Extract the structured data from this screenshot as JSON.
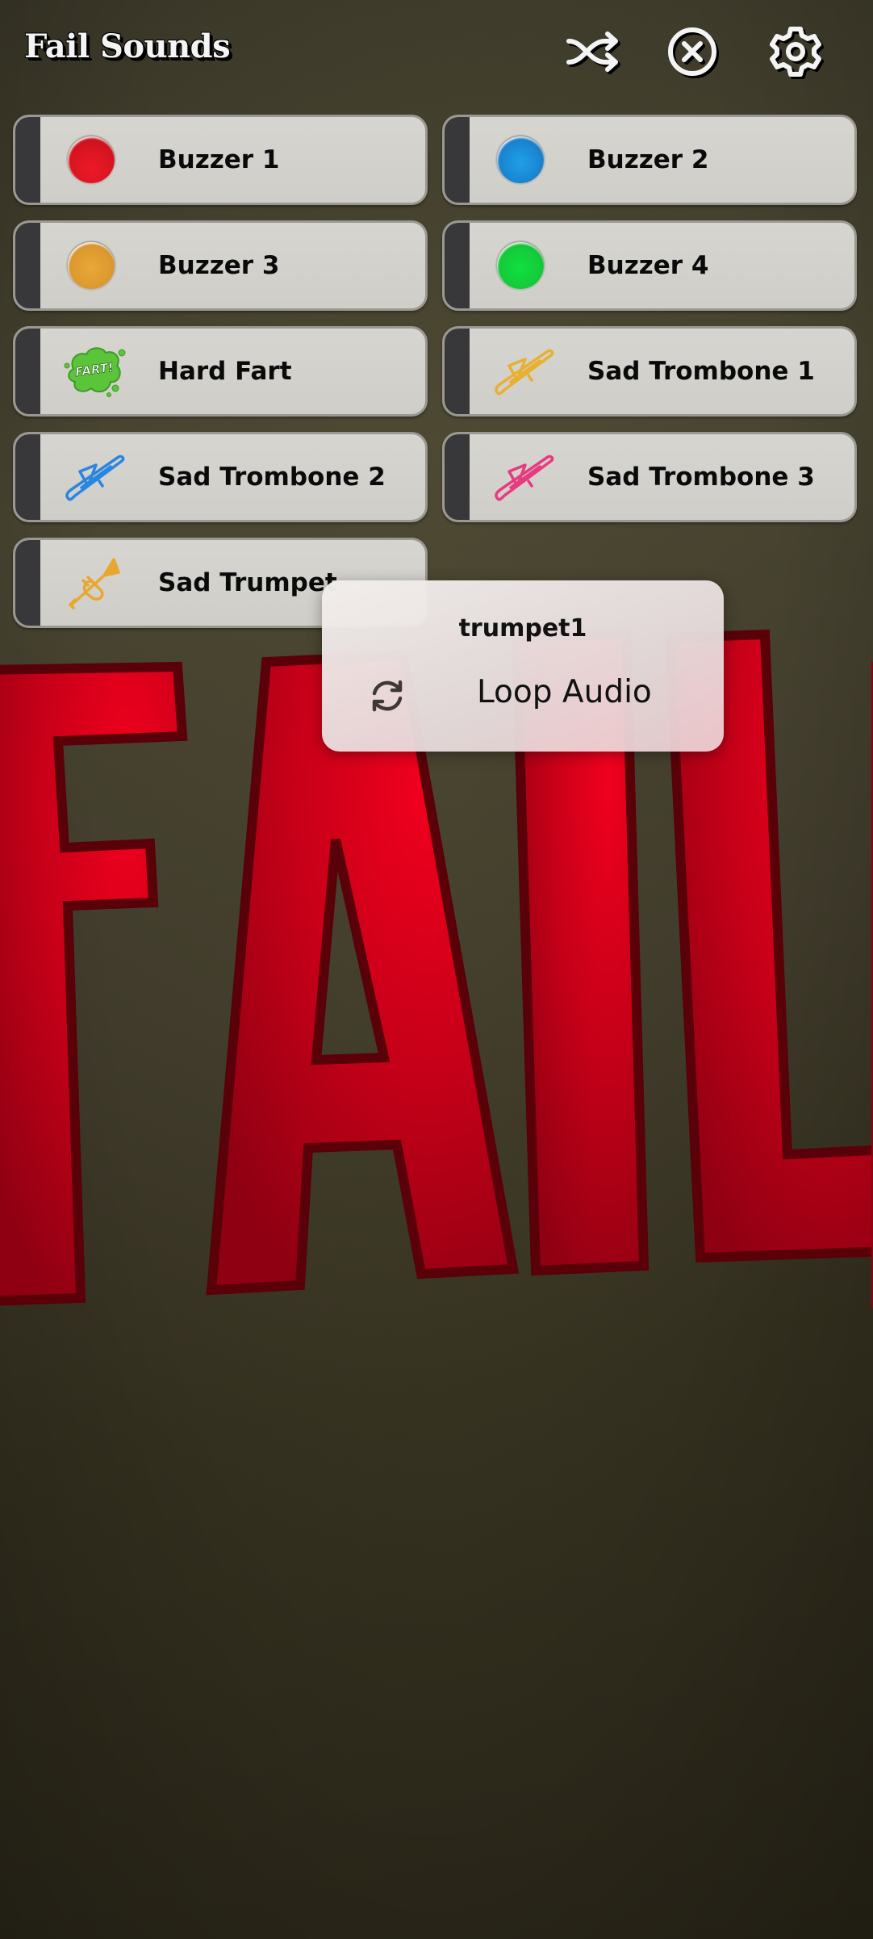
{
  "app": {
    "title": "Fail Sounds"
  },
  "header": {
    "actions": [
      {
        "id": "shuffle",
        "icon": "shuffle-icon"
      },
      {
        "id": "stop",
        "icon": "close-circle-icon"
      },
      {
        "id": "settings",
        "icon": "gear-icon"
      }
    ]
  },
  "sounds": [
    {
      "label": "Buzzer 1",
      "icon": "red-buzzer-icon",
      "color": "#e01a24"
    },
    {
      "label": "Buzzer 2",
      "icon": "blue-buzzer-icon",
      "color": "#1a8ad6"
    },
    {
      "label": "Buzzer 3",
      "icon": "orange-buzzer-icon",
      "color": "#e0a032"
    },
    {
      "label": "Buzzer 4",
      "icon": "green-buzzer-icon",
      "color": "#16d43c"
    },
    {
      "label": "Hard Fart",
      "icon": "fart-cloud-icon",
      "icon_text": "FART!",
      "color": "#5cc43a"
    },
    {
      "label": "Sad Trombone 1",
      "icon": "trombone-icon",
      "color": "#e8b030"
    },
    {
      "label": "Sad Trombone 2",
      "icon": "trombone-icon",
      "color": "#2a86e0"
    },
    {
      "label": "Sad Trombone 3",
      "icon": "trombone-icon",
      "color": "#e83a80"
    },
    {
      "label": "Sad Trumpet",
      "icon": "trumpet-icon",
      "color": "#e8a830"
    }
  ],
  "background_art": {
    "text": "FAIL",
    "fill": "#d0001a",
    "outline": "#5a0008"
  },
  "context_menu": {
    "title": "trumpet1",
    "items": [
      {
        "label": "Loop Audio",
        "icon": "loop-icon"
      }
    ]
  }
}
